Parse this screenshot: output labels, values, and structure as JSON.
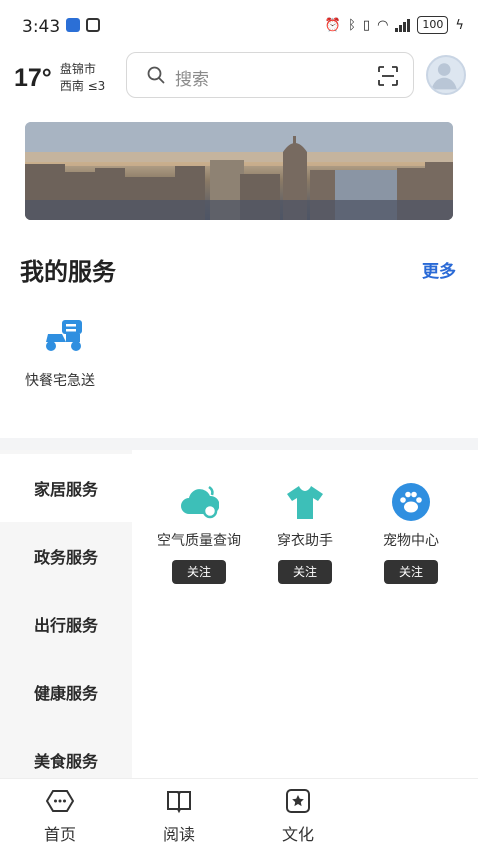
{
  "status_bar": {
    "time": "3:43",
    "battery": "100"
  },
  "weather": {
    "temperature": "17°",
    "city": "盘锦市",
    "wind": "西南 ≤3"
  },
  "search": {
    "placeholder": "搜索"
  },
  "my_services": {
    "title": "我的服务",
    "more_label": "更多",
    "items": [
      {
        "label": "快餐宅急送",
        "icon": "scooter-icon"
      }
    ]
  },
  "categories": [
    {
      "label": "家居服务",
      "active": true
    },
    {
      "label": "政务服务",
      "active": false
    },
    {
      "label": "出行服务",
      "active": false
    },
    {
      "label": "健康服务",
      "active": false
    },
    {
      "label": "美食服务",
      "active": false
    }
  ],
  "category_services": [
    {
      "label": "空气质量查询",
      "icon": "air-quality-icon",
      "button": "关注"
    },
    {
      "label": "穿衣助手",
      "icon": "tshirt-icon",
      "button": "关注"
    },
    {
      "label": "宠物中心",
      "icon": "paw-icon",
      "button": "关注"
    }
  ],
  "bottom_nav": [
    {
      "label": "首页",
      "icon": "home-icon"
    },
    {
      "label": "阅读",
      "icon": "book-icon"
    },
    {
      "label": "文化",
      "icon": "culture-icon"
    }
  ],
  "colors": {
    "accent": "#2a6ad6",
    "service_icon": "#3dbfb8",
    "pet_icon": "#2f8fe0",
    "button_bg": "#333333"
  }
}
